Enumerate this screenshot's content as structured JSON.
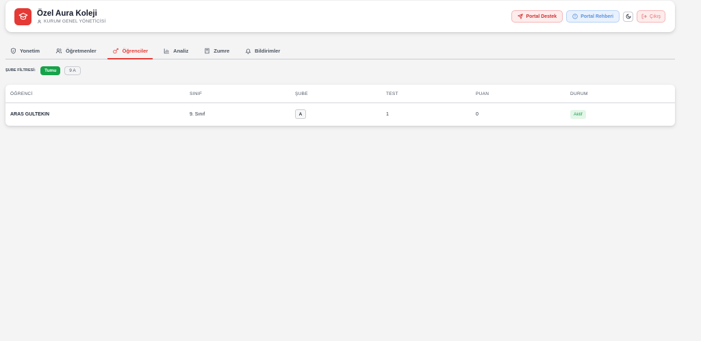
{
  "header": {
    "title": "Özel Aura Koleji",
    "subtitle": "KURUM GENEL YÖNETİCİSİ",
    "buttons": {
      "support": "Portal Destek",
      "guide": "Portal Rehberi",
      "logout": "Çıkış"
    }
  },
  "tabs": [
    {
      "label": "Yonetim",
      "icon": "shield-icon",
      "active": false
    },
    {
      "label": "Öğretmenler",
      "icon": "users-icon",
      "active": false
    },
    {
      "label": "Öğrenciler",
      "icon": "students-icon",
      "active": true
    },
    {
      "label": "Analiz",
      "icon": "bar-chart-icon",
      "active": false
    },
    {
      "label": "Zumre",
      "icon": "book-icon",
      "active": false
    },
    {
      "label": "Bildirimler",
      "icon": "bell-icon",
      "active": false
    }
  ],
  "filter": {
    "label": "ŞUBE FİLTRESİ:",
    "options": [
      "Tumu",
      "9 A"
    ],
    "selected": "Tumu"
  },
  "table": {
    "columns": [
      "ÖĞRENCİ",
      "SINIF",
      "ŞUBE",
      "TEST",
      "PUAN",
      "DURUM"
    ],
    "rows": [
      {
        "student": "ARAS GULTEKIN",
        "class": "9. Sınıf",
        "branch": "A",
        "test": "1",
        "score": "0",
        "status": "Aktif"
      }
    ]
  },
  "colors": {
    "accent": "#e53935",
    "success": "#16a34a",
    "info": "#5b93dd",
    "background": "#f4f4f4"
  }
}
